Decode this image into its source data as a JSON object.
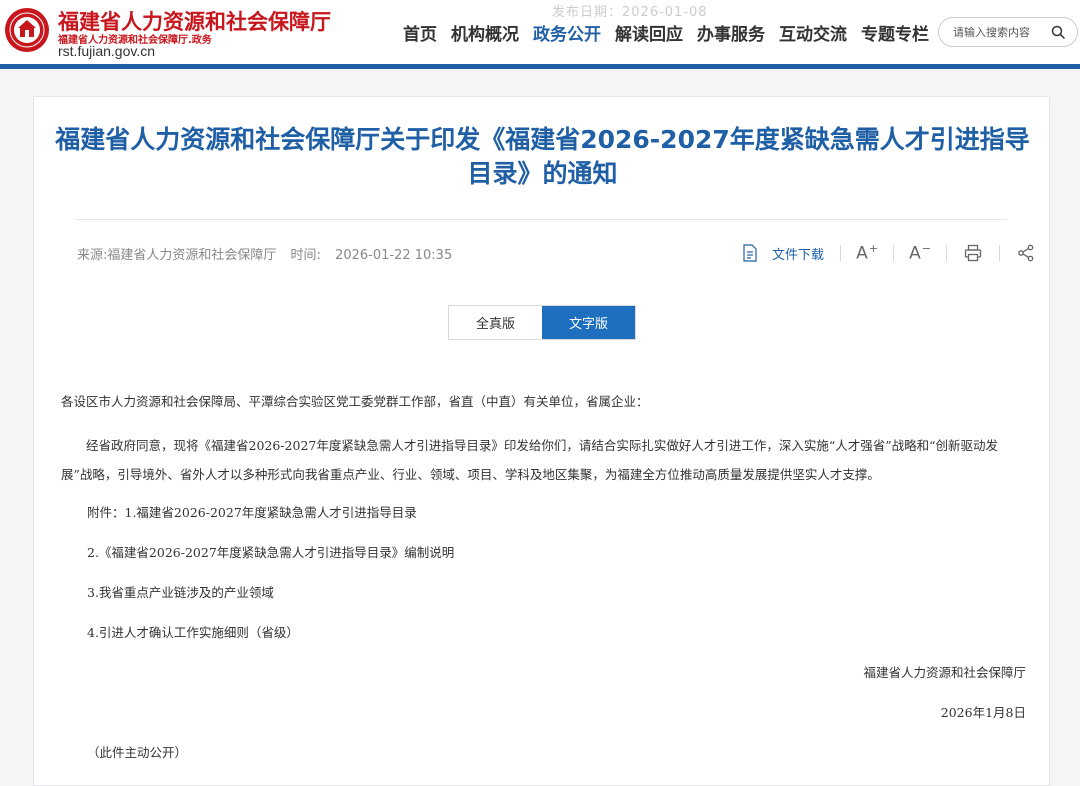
{
  "header": {
    "brand_title": "福建省人力资源和社会保障厅",
    "brand_sub": "福建省人力资源和社会保障厅.政务",
    "brand_domain": "rst.fujian.gov.cn",
    "faded_date": "发布日期：2026-01-08",
    "nav": [
      "首页",
      "机构概况",
      "政务公开",
      "解读回应",
      "办事服务",
      "互动交流",
      "专题专栏"
    ],
    "nav_active_index": 2,
    "search_placeholder": "请输入搜索内容"
  },
  "article": {
    "title": "福建省人力资源和社会保障厅关于印发《福建省2026-2027年度紧缺急需人才引进指导目录》的通知",
    "source": "来源:福建省人力资源和社会保障厅",
    "time_label": "时间:",
    "time_value": "2026-01-22 10:35",
    "tools": {
      "download_label": "文件下载",
      "font_larger": "A",
      "font_smaller": "A"
    },
    "versions": [
      "全真版",
      "文字版"
    ],
    "version_active_index": 1,
    "salutation": "各设区市人力资源和社会保障局、平潭综合实验区党工委党群工作部，省直（中直）有关单位，省属企业：",
    "main_paragraph": "经省政府同意，现将《福建省2026-2027年度紧缺急需人才引进指导目录》印发给你们，请结合实际扎实做好人才引进工作，深入实施“人才强省”战略和“创新驱动发展”战略，引导境外、省外人才以多种形式向我省重点产业、行业、领域、项目、学科及地区集聚，为福建全方位推动高质量发展提供坚实人才支撑。",
    "attachments": [
      "附件：1.福建省2026-2027年度紧缺急需人才引进指导目录",
      "2.《福建省2026-2027年度紧缺急需人才引进指导目录》编制说明",
      "3.我省重点产业链涉及的产业领域",
      "4.引进人才确认工作实施细则（省级）"
    ],
    "signature": "福建省人力资源和社会保障厅",
    "sign_date": "2026年1月8日",
    "note": "（此件主动公开）"
  },
  "colors": {
    "brand_red": "#c8161d",
    "primary_blue": "#1f5fa6",
    "active_button": "#1f6fc0"
  }
}
